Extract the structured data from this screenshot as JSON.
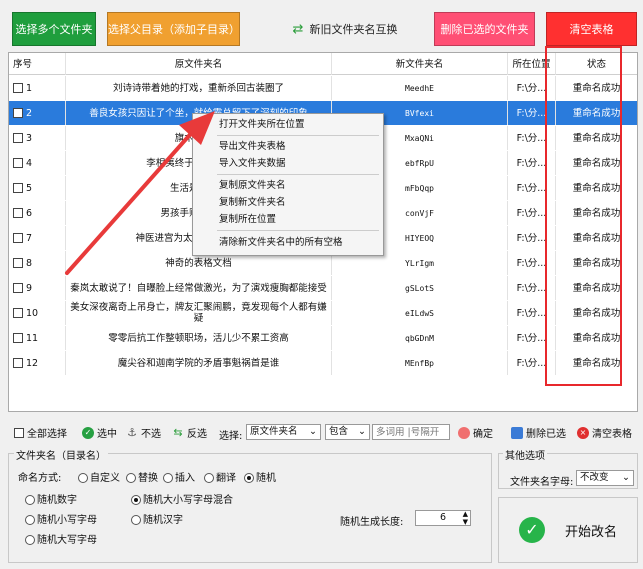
{
  "toolbar": {
    "select_multiple": "选择多个文件夹",
    "select_parent": "选择父目录（添加子目录）",
    "swap_names": "新旧文件夹名互换",
    "delete_selected": "删除已选的文件夹",
    "clear_table": "清空表格"
  },
  "table": {
    "headers": [
      "序号",
      "原文件夹名",
      "新文件夹名",
      "所在位置",
      "状态"
    ],
    "rows": [
      {
        "idx": "1",
        "orig": "刘诗诗带着她的打戏，重新杀回古装圈了",
        "new": "MeedhE",
        "loc": "F:\\分...",
        "status": "重命名成功"
      },
      {
        "idx": "2",
        "orig": "善良女孩只因让了个坐，就给霸总留下了深刻的印象",
        "new": "BVfexi",
        "loc": "F:\\分...",
        "status": "重命名成功"
      },
      {
        "idx": "3",
        "orig": "旗木卡卡西",
        "new": "MxaQNi",
        "loc": "F:\\分...",
        "status": "重命名成功"
      },
      {
        "idx": "4",
        "orig": "李相夷终于和乔婉娩相见",
        "new": "ebfRpU",
        "loc": "F:\\分...",
        "status": "重命名成功"
      },
      {
        "idx": "5",
        "orig": "生活是一场自",
        "new": "mFbQqp",
        "loc": "F:\\分...",
        "status": "重命名成功"
      },
      {
        "idx": "6",
        "orig": "男孩手贱搞鼓神链",
        "new": "conVjF",
        "loc": "F:\\分...",
        "status": "重命名成功"
      },
      {
        "idx": "7",
        "orig": "神医进宫为太子看病，20米长",
        "new": "HIYEOQ",
        "loc": "F:\\分...",
        "status": "重命名成功"
      },
      {
        "idx": "8",
        "orig": "神奇的表格文档",
        "new": "YLrIgm",
        "loc": "F:\\分...",
        "status": "重命名成功"
      },
      {
        "idx": "9",
        "orig": "秦岚太敢说了！自曝脸上经常做激光，为了演戏瘦胸都能接受",
        "new": "gSLotS",
        "loc": "F:\\分...",
        "status": "重命名成功"
      },
      {
        "idx": "10",
        "orig": "美女深夜离奇上吊身亡，牌友汇聚闹鹏，竟发现每个人都有嫌疑",
        "new": "eILdwS",
        "loc": "F:\\分...",
        "status": "重命名成功"
      },
      {
        "idx": "11",
        "orig": "零零后抗工作整顿职场，活儿少不累工资高",
        "new": "qbGDnM",
        "loc": "F:\\分...",
        "status": "重命名成功"
      },
      {
        "idx": "12",
        "orig": "魔尖谷和迦南学院的矛盾事魁祸首是谁",
        "new": "MEnfBp",
        "loc": "F:\\分...",
        "status": "重命名成功"
      }
    ]
  },
  "context_menu": {
    "open_location": "打开文件夹所在位置",
    "export_table": "导出文件夹表格",
    "import_data": "导入文件夹数据",
    "copy_orig": "复制原文件夹名",
    "copy_new": "复制新文件夹名",
    "copy_loc": "复制所在位置",
    "clear_spaces": "清除新文件夹名中的所有空格"
  },
  "bottom_tools": {
    "select_all": "全部选择",
    "select": "选中",
    "deselect": "不选",
    "invert": "反选",
    "choose_label": "选择:",
    "field_value": "原文件夹名",
    "op_value": "包含",
    "keyword_placeholder": "多词用 |号隔开",
    "confirm": "确定",
    "delete_selected": "删除已选",
    "clear_table": "清空表格"
  },
  "options": {
    "group_title": "文件夹名（目录名）",
    "naming_label": "命名方式:",
    "modes": [
      "自定义",
      "替换",
      "插入",
      "翻译",
      "随机"
    ],
    "random_types": [
      "随机数字",
      "随机大小写字母混合",
      "随机小写字母",
      "随机汉字",
      "随机大写字母"
    ],
    "length_label": "随机生成长度:",
    "length_value": "6",
    "other_title": "其他选项",
    "case_label": "文件夹名字母:",
    "case_value": "不改变",
    "start_label": "开始改名"
  },
  "colors": {
    "selected_row": "#2a7bdc",
    "status_box": "#e8282c",
    "arrow": "#e83a3a"
  }
}
